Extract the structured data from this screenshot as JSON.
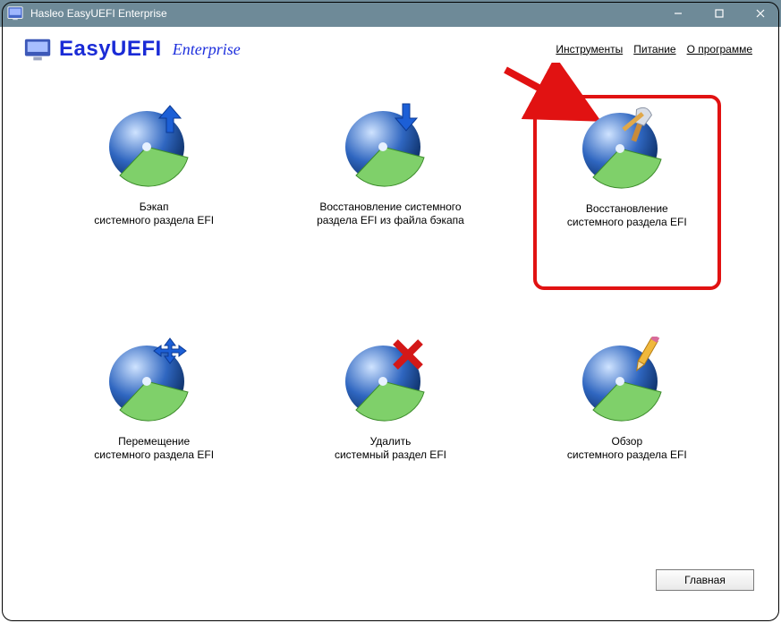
{
  "window": {
    "title": "Hasleo EasyUEFI Enterprise"
  },
  "header": {
    "brand": "EasyUEFI",
    "edition": "Enterprise",
    "menus": {
      "tools": "Инструменты",
      "power": "Питание",
      "about": "О программе"
    }
  },
  "tiles": {
    "backup": {
      "l1": "Бэкап",
      "l2": "системного раздела EFI"
    },
    "restoreF": {
      "l1": "Восстановление системного",
      "l2": "раздела EFI из файла бэкапа"
    },
    "restoreP": {
      "l1": "Восстановление",
      "l2": "системного раздела EFI"
    },
    "move": {
      "l1": "Перемещение",
      "l2": "системного раздела EFI"
    },
    "delete": {
      "l1": "Удалить",
      "l2": "системный раздел EFI"
    },
    "overview": {
      "l1": "Обзор",
      "l2": "системного раздела EFI"
    }
  },
  "footer": {
    "main": "Главная"
  }
}
